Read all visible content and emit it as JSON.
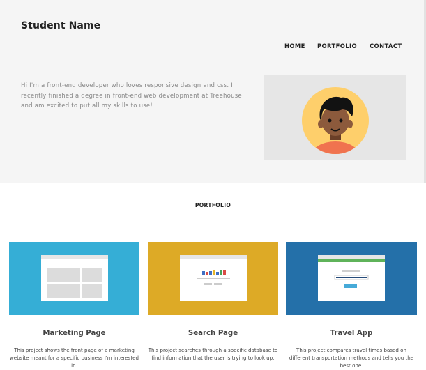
{
  "site": {
    "title": "Student Name"
  },
  "nav": {
    "items": [
      {
        "label": "HOME"
      },
      {
        "label": "PORTFOLIO"
      },
      {
        "label": "CONTACT"
      }
    ]
  },
  "intro": {
    "text": "Hi I'm a front-end developer who loves responsive design and css. I recently finished a degree in front-end web development at Treehouse and am excited to put all my skills to use!"
  },
  "portfolio": {
    "heading": "PORTFOLIO",
    "projects": [
      {
        "title": "Marketing Page",
        "description": "This project shows the front page of a marketing website meant for a specific business I'm interested in.",
        "color": "#35aed6"
      },
      {
        "title": "Search Page",
        "description": "This project searches through a specific database to find information that the user is trying to look up.",
        "color": "#ddaa26"
      },
      {
        "title": "Travel App",
        "description": "This project compares travel times based on different transportation methods and tells you the best one.",
        "color": "#2470a9"
      }
    ]
  },
  "colors": {
    "header_bg": "#f5f5f5",
    "avatar_bg": "#e6e6e6",
    "avatar_circle": "#fecf6b",
    "skin": "#8c5a3c",
    "hair": "#121212",
    "shirt": "#f0734f"
  }
}
